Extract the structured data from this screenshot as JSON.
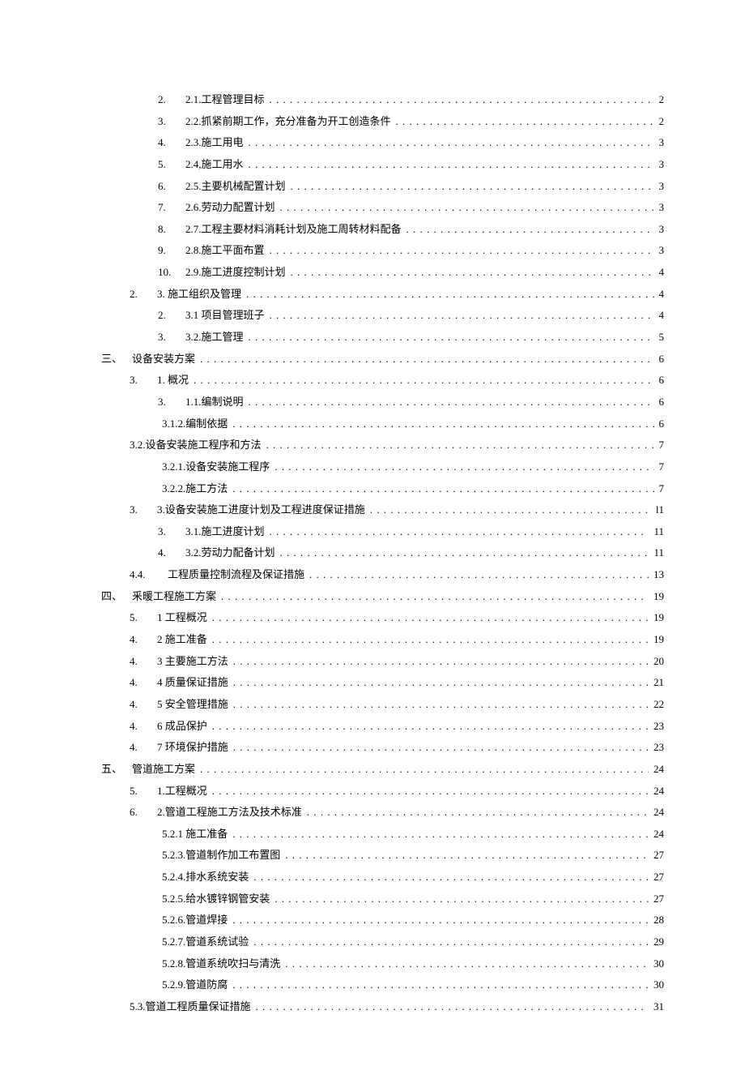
{
  "toc": [
    {
      "indent": 2,
      "prefix": "2.",
      "title": "2.1.工程管理目标",
      "page": "2"
    },
    {
      "indent": 2,
      "prefix": "3.",
      "title": "2.2.抓紧前期工作，充分准备为开工创造条件",
      "page": "2"
    },
    {
      "indent": 2,
      "prefix": "4.",
      "title": "2.3.施工用电",
      "page": "3"
    },
    {
      "indent": 2,
      "prefix": "5.",
      "title": "2.4,施工用水",
      "page": "3"
    },
    {
      "indent": 2,
      "prefix": "6.",
      "title": "2.5.主要机械配置计划",
      "page": "3"
    },
    {
      "indent": 2,
      "prefix": "7.",
      "title": "2.6.劳动力配置计划",
      "page": "3"
    },
    {
      "indent": 2,
      "prefix": "8.",
      "title": "2.7.工程主要材料消耗计划及施工周转材料配备",
      "page": "3"
    },
    {
      "indent": 2,
      "prefix": "9.",
      "title": "2.8.施工平面布置",
      "page": "3"
    },
    {
      "indent": 2,
      "prefix": "10.",
      "title": "2.9.施工进度控制计划",
      "page": "4"
    },
    {
      "indent": 1,
      "prefix": "2.",
      "title": "3. 施工组织及管理",
      "page": "4"
    },
    {
      "indent": 2,
      "prefix": "2.",
      "title": "3.1 项目管理班子",
      "page": "4"
    },
    {
      "indent": 2,
      "prefix": "3.",
      "title": "3.2.施工管理",
      "page": "5"
    },
    {
      "indent": 0,
      "prefix": "三、",
      "title": "设备安装方案",
      "page": "6"
    },
    {
      "indent": 1,
      "prefix": "3.",
      "title": "1. 概况",
      "page": "6"
    },
    {
      "indent": 2,
      "prefix": "3.",
      "title": "1.1.编制说明",
      "page": "6"
    },
    {
      "indent": 3,
      "prefix": "",
      "title": "3.1.2.编制依据",
      "page": "6"
    },
    {
      "indent": 1,
      "prefix": "",
      "title": "3.2.设备安装施工程序和方法",
      "page": "7"
    },
    {
      "indent": 3,
      "prefix": "",
      "title": "3.2.1.设备安装施工程序",
      "page": "7"
    },
    {
      "indent": 3,
      "prefix": "",
      "title": "3.2.2.施工方法",
      "page": "7"
    },
    {
      "indent": 1,
      "prefix": "3.",
      "title": "3.设备安装施工进度计划及工程进度保证措施",
      "page": "l1"
    },
    {
      "indent": 2,
      "prefix": "3.",
      "title": "3.1.施工进度计划",
      "page": "11"
    },
    {
      "indent": 2,
      "prefix": "4.",
      "title": "3.2.劳动力配备计划",
      "page": "11"
    },
    {
      "indent": 1,
      "prefix": "4.4.",
      "title": "　工程质量控制流程及保证措施",
      "page": "13"
    },
    {
      "indent": 0,
      "prefix": "四、",
      "title": "釆暖工程施工方案",
      "page": "19"
    },
    {
      "indent": 1,
      "prefix": "5.",
      "title": "1 工程概况",
      "page": "19"
    },
    {
      "indent": 1,
      "prefix": "4.",
      "title": "2 施工准备",
      "page": "19"
    },
    {
      "indent": 1,
      "prefix": "4.",
      "title": "3 主要施工方法",
      "page": "20"
    },
    {
      "indent": 1,
      "prefix": "4.",
      "title": "4 质量保证措施",
      "page": "21"
    },
    {
      "indent": 1,
      "prefix": "4.",
      "title": "5 安全管理措施",
      "page": "22"
    },
    {
      "indent": 1,
      "prefix": "4.",
      "title": "6 成品保护",
      "page": "23"
    },
    {
      "indent": 1,
      "prefix": "4.",
      "title": "7 环境保护措施",
      "page": "23"
    },
    {
      "indent": 0,
      "prefix": "五、",
      "title": "管道施工方案",
      "page": "24"
    },
    {
      "indent": 1,
      "prefix": "5.",
      "title": "1.工程概况",
      "page": "24"
    },
    {
      "indent": 1,
      "prefix": "6.",
      "title": "2.管道工程施工方法及技术标准",
      "page": "24"
    },
    {
      "indent": 3,
      "prefix": "",
      "title": "5.2.1 施工准备",
      "page": "24"
    },
    {
      "indent": 3,
      "prefix": "",
      "title": "5.2.3.管道制作加工布置图",
      "page": "27"
    },
    {
      "indent": 3,
      "prefix": "",
      "title": "5.2.4.排水系统安装",
      "page": "27"
    },
    {
      "indent": 3,
      "prefix": "",
      "title": "5.2.5.给水镀锌钢管安装",
      "page": "27"
    },
    {
      "indent": 3,
      "prefix": "",
      "title": "5.2.6.管道焊接",
      "page": "28"
    },
    {
      "indent": 3,
      "prefix": "",
      "title": "5.2.7.管道系统试验",
      "page": "29"
    },
    {
      "indent": 3,
      "prefix": "",
      "title": "5.2.8.管道系统吹扫与清洗",
      "page": "30"
    },
    {
      "indent": 3,
      "prefix": "",
      "title": "5.2.9.管道防腐",
      "page": "30"
    },
    {
      "indent": 1,
      "prefix": "",
      "title": "5.3.管道工程质量保证措施",
      "page": "31"
    }
  ]
}
